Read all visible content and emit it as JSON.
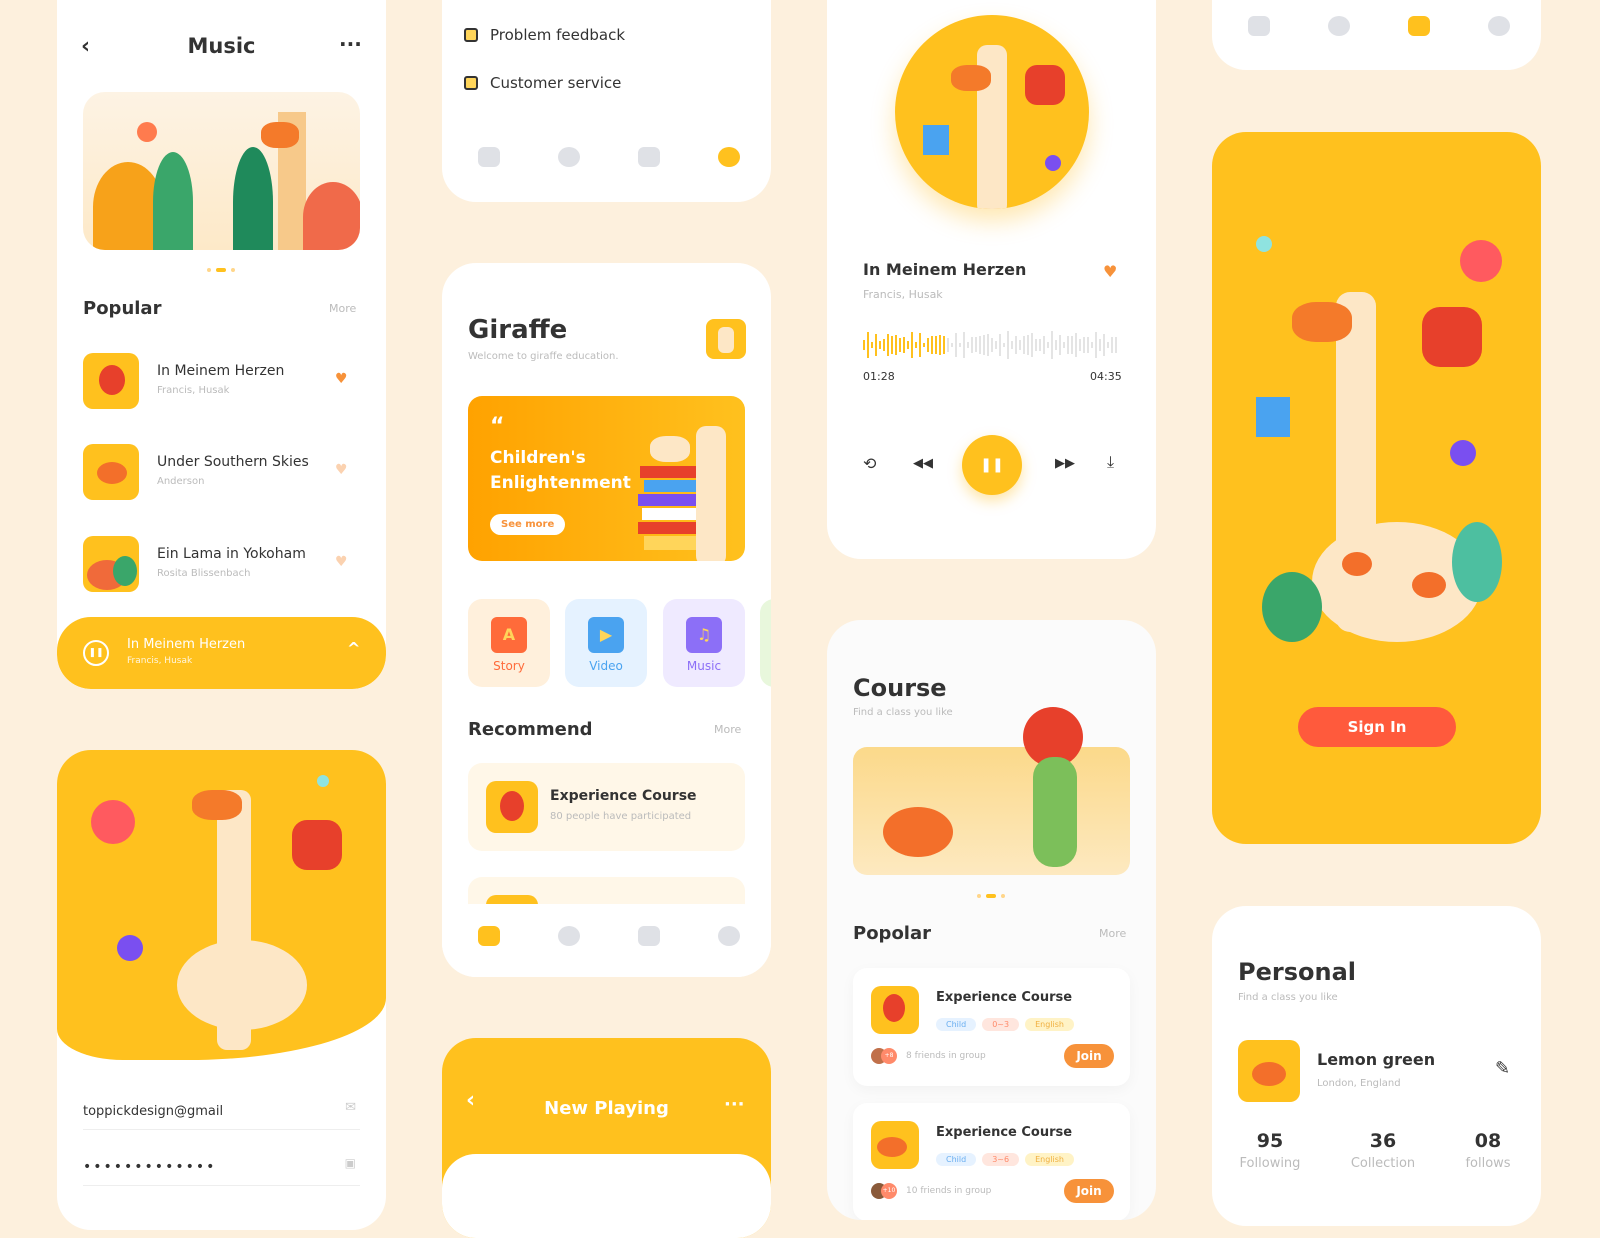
{
  "colors": {
    "accent": "#ffc11e",
    "orange": "#f7923a",
    "signin": "#ff5a3c",
    "background": "#fdf0dd"
  },
  "music": {
    "title": "Music",
    "back_icon": "chevron-left",
    "more_icon": "ellipsis",
    "popular": "Popular",
    "more": "More",
    "songs": [
      {
        "title": "In Meinem Herzen",
        "artist": "Francis, Husak"
      },
      {
        "title": "Under Southern Skies",
        "artist": "Anderson"
      },
      {
        "title": "Ein Lama in Yokoham",
        "artist": "Rosita Blissenbach"
      }
    ],
    "now_playing": {
      "title": "In Meinem Herzen",
      "artist": "Francis, Husak"
    }
  },
  "login": {
    "email": "toppickdesign@gmail",
    "password": "•••••••••••••"
  },
  "menu": {
    "items": [
      "Problem feedback",
      "Customer service"
    ]
  },
  "giraffe": {
    "title": "Giraffe",
    "subtitle": "Welcome to giraffe education.",
    "banner_quote": "“",
    "banner_title": "Children's Enlightenment",
    "banner_button": "See more",
    "categories": [
      "Story",
      "Video",
      "Music"
    ],
    "recommend": "Recommend",
    "more": "More",
    "course": {
      "title": "Experience Course",
      "sub": "80 people have participated"
    }
  },
  "new_playing": {
    "title": "New Playing"
  },
  "player": {
    "title": "In Meinem Herzen",
    "artist": "Francis, Husak",
    "elapsed": "01:28",
    "total": "04:35",
    "progress": 0.32
  },
  "course": {
    "title": "Course",
    "subtitle": "Find a class you like",
    "popular": "Popolar",
    "more": "More",
    "items": [
      {
        "title": "Experience Course",
        "tags": [
          "Child",
          "0~3",
          "English"
        ],
        "badge": "+8",
        "friends": "8 friends in group",
        "join": "Join"
      },
      {
        "title": "Experience Course",
        "tags": [
          "Child",
          "3~6",
          "English"
        ],
        "badge": "+10",
        "friends": "10 friends in group",
        "join": "Join"
      }
    ]
  },
  "signin": {
    "button": "Sign In"
  },
  "personal": {
    "title": "Personal",
    "subtitle": "Find a class you like",
    "name": "Lemon green",
    "location": "London, England",
    "stats": [
      {
        "value": "95",
        "label": "Following"
      },
      {
        "value": "36",
        "label": "Collection"
      },
      {
        "value": "08",
        "label": "follows"
      }
    ]
  }
}
